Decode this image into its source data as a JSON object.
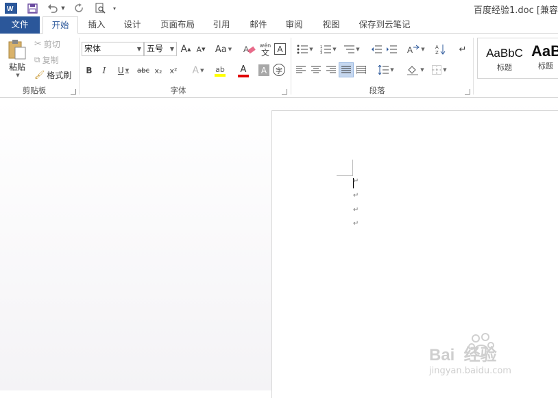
{
  "title_bar": {
    "app_icon": "word-logo-icon",
    "save_icon": "save-icon",
    "undo_icon": "undo-icon",
    "redo_icon": "redo-icon",
    "print_preview_icon": "print-preview-icon",
    "customize_icon": "customize-qat-icon",
    "document_title": "百度经验1.doc [兼容"
  },
  "tabs": [
    {
      "label": "文件"
    },
    {
      "label": "开始"
    },
    {
      "label": "插入"
    },
    {
      "label": "设计"
    },
    {
      "label": "页面布局"
    },
    {
      "label": "引用"
    },
    {
      "label": "邮件"
    },
    {
      "label": "审阅"
    },
    {
      "label": "视图"
    },
    {
      "label": "保存到云笔记"
    }
  ],
  "clipboard": {
    "group_label": "剪贴板",
    "paste": "粘贴",
    "cut": "剪切",
    "copy": "复制",
    "format_painter": "格式刷"
  },
  "font": {
    "group_label": "字体",
    "font_name": "宋体",
    "font_size": "五号",
    "grow": "A",
    "shrink": "A",
    "change_case": "Aa",
    "clear_format_icon": "eraser-icon",
    "phonetic": "wén",
    "phonetic_char": "文",
    "char_border": "A",
    "bold": "B",
    "italic": "I",
    "underline": "U",
    "strike": "abc",
    "subscript": "x₂",
    "superscript": "x²",
    "text_effect": "A",
    "highlight": "ab",
    "font_color": "A",
    "char_shading": "A",
    "enclose": "字",
    "highlight_color": "#ffff00",
    "font_color_bar": "#e00000"
  },
  "paragraph": {
    "group_label": "段落"
  },
  "styles": {
    "sample1": "AaBbC",
    "label1": "标题",
    "sample2": "AaB",
    "label2": "标题"
  },
  "document": {
    "paragraph_marks": [
      "↵",
      "↵",
      "↵",
      "↵"
    ]
  },
  "watermark": {
    "brand": "Bai  经验",
    "url": "jingyan.baidu.com"
  },
  "colors": {
    "file_tab": "#2b579a",
    "accent": "#2b579a"
  }
}
